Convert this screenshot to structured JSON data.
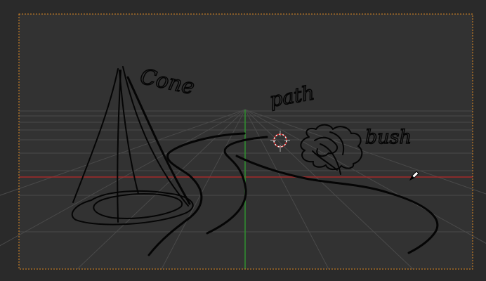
{
  "viewport": {
    "background": "#2f2f2f",
    "camera_frame_color": "#e08a23",
    "grid_color": "#4a4a4a",
    "x_axis_color": "#a52929",
    "y_axis_color": "#2f8f2f"
  },
  "annotations": {
    "cone": "Cone",
    "path": "path",
    "bush": "bush"
  },
  "icons": {
    "cursor": "grease-pencil-cursor-icon",
    "origin": "3d-cursor-icon"
  },
  "ink_color": "#050505"
}
